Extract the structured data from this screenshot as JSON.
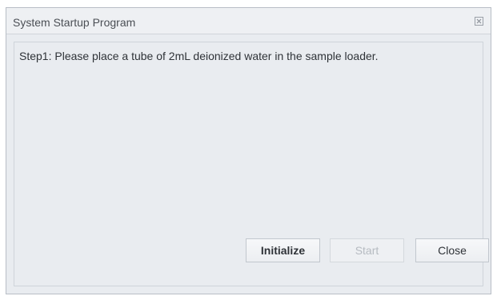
{
  "dialog": {
    "title": "System Startup Program",
    "close_icon": "close-icon",
    "step_text": "Step1:  Please place a tube of 2mL deionized water in the sample loader."
  },
  "buttons": {
    "initialize": "Initialize",
    "start": "Start",
    "close": "Close"
  },
  "states": {
    "start_enabled": false
  },
  "colors": {
    "background": "#e9ecf0",
    "border": "#b8bec6",
    "text": "#2f3338",
    "disabled_text": "#b6bbc1"
  }
}
